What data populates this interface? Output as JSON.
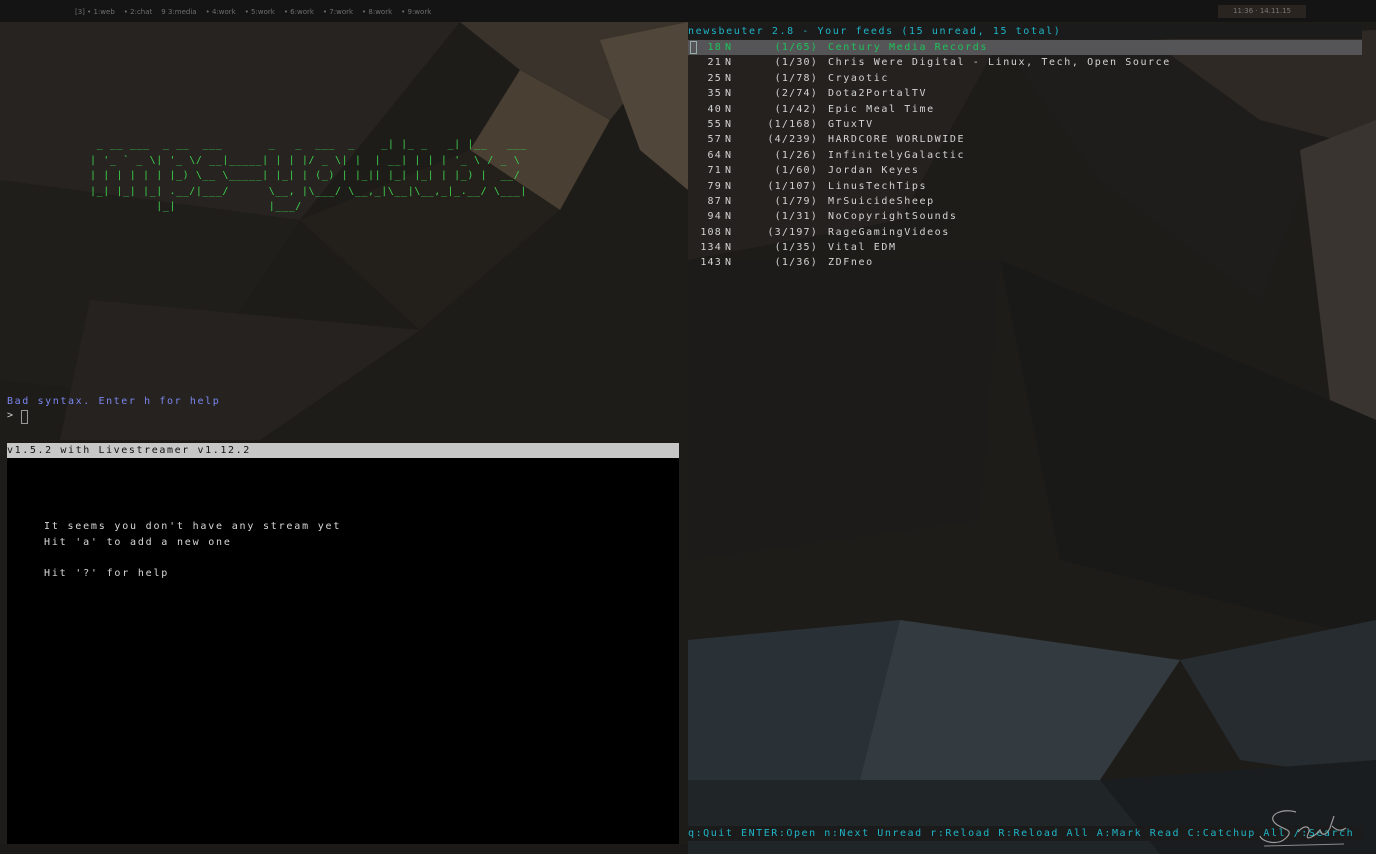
{
  "topbar": {
    "workspaces": [
      "[3] • 1:web",
      "• 2:chat",
      "9 3:media",
      "• 4:work",
      "• 5:work",
      "• 6:work",
      "• 7:work",
      "• 8:work",
      "• 9:work"
    ],
    "clock": "11:36 · 14.11.15"
  },
  "left_pane": {
    "ascii_banner": " _ __ ___  _ __  ___       _   _  ___  _    _| |_ _   _| |__   ___ \n| '_ ` _ \\| '_ \\/ __|_____| | | |/ _ \\| |  | __| | | | '_ \\ / _ \\\n| | | | | | |_) \\__ \\_____| |_| | (_) | |_|| |_| |_| | |_) |  __/\n|_| |_| |_| .__/|___/      \\__, |\\___/ \\__,_|\\__|\\__,_|_.__/ \\___|\n          |_|              |___/",
    "error_message": "Bad syntax. Enter h for help",
    "prompt": ">"
  },
  "livestreamer": {
    "header": "v1.5.2 with Livestreamer v1.12.2",
    "messages": [
      "It seems you don't have any stream yet",
      "Hit 'a' to add a new one",
      "Hit '?' for help"
    ]
  },
  "newsbeuter": {
    "title": "newsbeuter 2.8 - Your feeds (15 unread, 15 total)",
    "selected_index": 0,
    "feeds": [
      {
        "num": "18",
        "flag": "N",
        "count": "(1/65)",
        "title": "Century Media Records"
      },
      {
        "num": "21",
        "flag": "N",
        "count": "(1/30)",
        "title": "Chris Were Digital - Linux, Tech, Open Source"
      },
      {
        "num": "25",
        "flag": "N",
        "count": "(1/78)",
        "title": "Cryaotic"
      },
      {
        "num": "35",
        "flag": "N",
        "count": "(2/74)",
        "title": "Dota2PortalTV"
      },
      {
        "num": "40",
        "flag": "N",
        "count": "(1/42)",
        "title": "Epic Meal Time"
      },
      {
        "num": "55",
        "flag": "N",
        "count": "(1/168)",
        "title": "GTuxTV"
      },
      {
        "num": "57",
        "flag": "N",
        "count": "(4/239)",
        "title": "HARDCORE WORLDWIDE"
      },
      {
        "num": "64",
        "flag": "N",
        "count": "(1/26)",
        "title": "InfinitelyGalactic"
      },
      {
        "num": "71",
        "flag": "N",
        "count": "(1/60)",
        "title": "Jordan Keyes"
      },
      {
        "num": "79",
        "flag": "N",
        "count": "(1/107)",
        "title": "LinusTechTips"
      },
      {
        "num": "87",
        "flag": "N",
        "count": "(1/79)",
        "title": "MrSuicideSheep"
      },
      {
        "num": "94",
        "flag": "N",
        "count": "(1/31)",
        "title": "NoCopyrightSounds"
      },
      {
        "num": "108",
        "flag": "N",
        "count": "(3/197)",
        "title": "RageGamingVideos"
      },
      {
        "num": "134",
        "flag": "N",
        "count": "(1/35)",
        "title": "Vital EDM"
      },
      {
        "num": "143",
        "flag": "N",
        "count": "(1/36)",
        "title": "ZDFneo"
      }
    ],
    "help": "q:Quit ENTER:Open n:Next Unread r:Reload R:Reload All A:Mark Read C:Catchup All /:Search ?:Help"
  },
  "colors": {
    "accent_cyan": "#1fb5c7",
    "selected_green": "#1fc25b",
    "ascii_green": "#3fd04d",
    "error_blue": "#7a87ee"
  }
}
